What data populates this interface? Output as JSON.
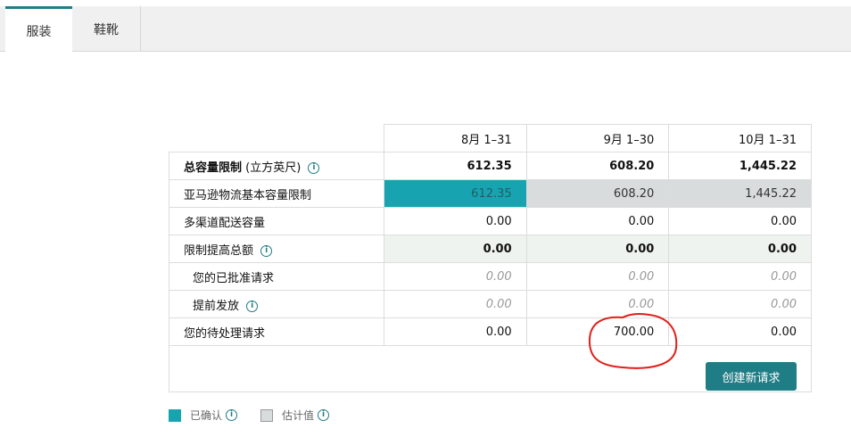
{
  "tabs": [
    {
      "label": "服装",
      "active": true
    },
    {
      "label": "鞋靴",
      "active": false
    }
  ],
  "table": {
    "columns": [
      "8月 1–31",
      "9月 1–30",
      "10月 1–31"
    ],
    "rows": {
      "total": {
        "label": "总容量限制",
        "sub": "(立方英尺)",
        "values": [
          "612.35",
          "608.20",
          "1,445.22"
        ]
      },
      "base": {
        "label": "亚马逊物流基本容量限制",
        "values": [
          "612.35",
          "608.20",
          "1,445.22"
        ]
      },
      "multi": {
        "label": "多渠道配送容量",
        "values": [
          "0.00",
          "0.00",
          "0.00"
        ]
      },
      "increase": {
        "label": "限制提高总额",
        "values": [
          "0.00",
          "0.00",
          "0.00"
        ]
      },
      "approved": {
        "label": "您的已批准请求",
        "values": [
          "0.00",
          "0.00",
          "0.00"
        ]
      },
      "advance": {
        "label": "提前发放",
        "values": [
          "0.00",
          "0.00",
          "0.00"
        ]
      },
      "pending": {
        "label": "您的待处理请求",
        "values": [
          "0.00",
          "700.00",
          "0.00"
        ]
      }
    }
  },
  "create_button": "创建新请求",
  "legend": {
    "confirmed": "已确认",
    "estimated": "估计值"
  },
  "colors": {
    "accent": "#1f7d85",
    "confirmed": "#17a4b0",
    "estimated": "#d8dcdc",
    "annotation": "#e0201a"
  }
}
